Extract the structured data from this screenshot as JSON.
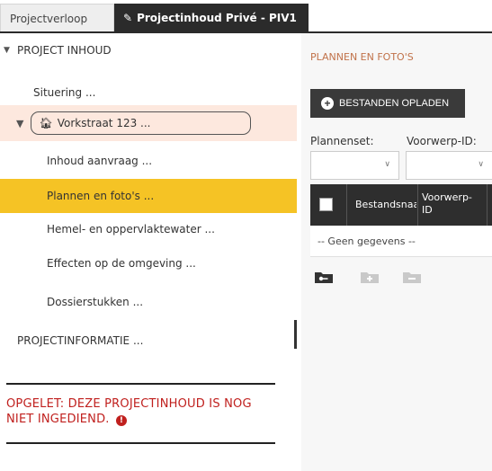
{
  "tabs": [
    {
      "label": "Projectverloop",
      "active": false
    },
    {
      "label": "Projectinhoud Privé - PIV1",
      "active": true,
      "icon": "pencil-icon"
    }
  ],
  "tree": {
    "root_label": "PROJECT INHOUD",
    "situering": "Situering ...",
    "address": "Vorkstraat 123 ...",
    "children": [
      "Inhoud aanvraag ...",
      "Plannen en foto's ...",
      "Hemel- en oppervlaktewater ...",
      "Effecten op de omgeving ...",
      "Dossierstukken ..."
    ],
    "selected": "Plannen en foto's ...",
    "projectinformatie": "PROJECTINFORMATIE ..."
  },
  "warning": {
    "text": "OPGELET: DEZE PROJECTINHOUD IS NOG NIET INGEDIEND.",
    "icon": "error-icon"
  },
  "panel": {
    "title": "PLANNEN EN FOTO'S",
    "upload_label": "BESTANDEN OPLADEN",
    "filters": [
      {
        "label": "Plannenset:",
        "value": ""
      },
      {
        "label": "Voorwerp-ID:",
        "value": ""
      }
    ],
    "columns": [
      "Bestandsnaam",
      "Voorwerp-ID"
    ],
    "empty_text": "-- Geen gegevens --",
    "folder_buttons": [
      "folder-key-icon",
      "folder-add-icon",
      "folder-remove-icon"
    ]
  },
  "colors": {
    "selected_row": "#f5c325",
    "address_row": "#fde8de",
    "warning": "#c0201e",
    "panel_title": "#c1724a",
    "active_tab": "#2b2b2b"
  }
}
